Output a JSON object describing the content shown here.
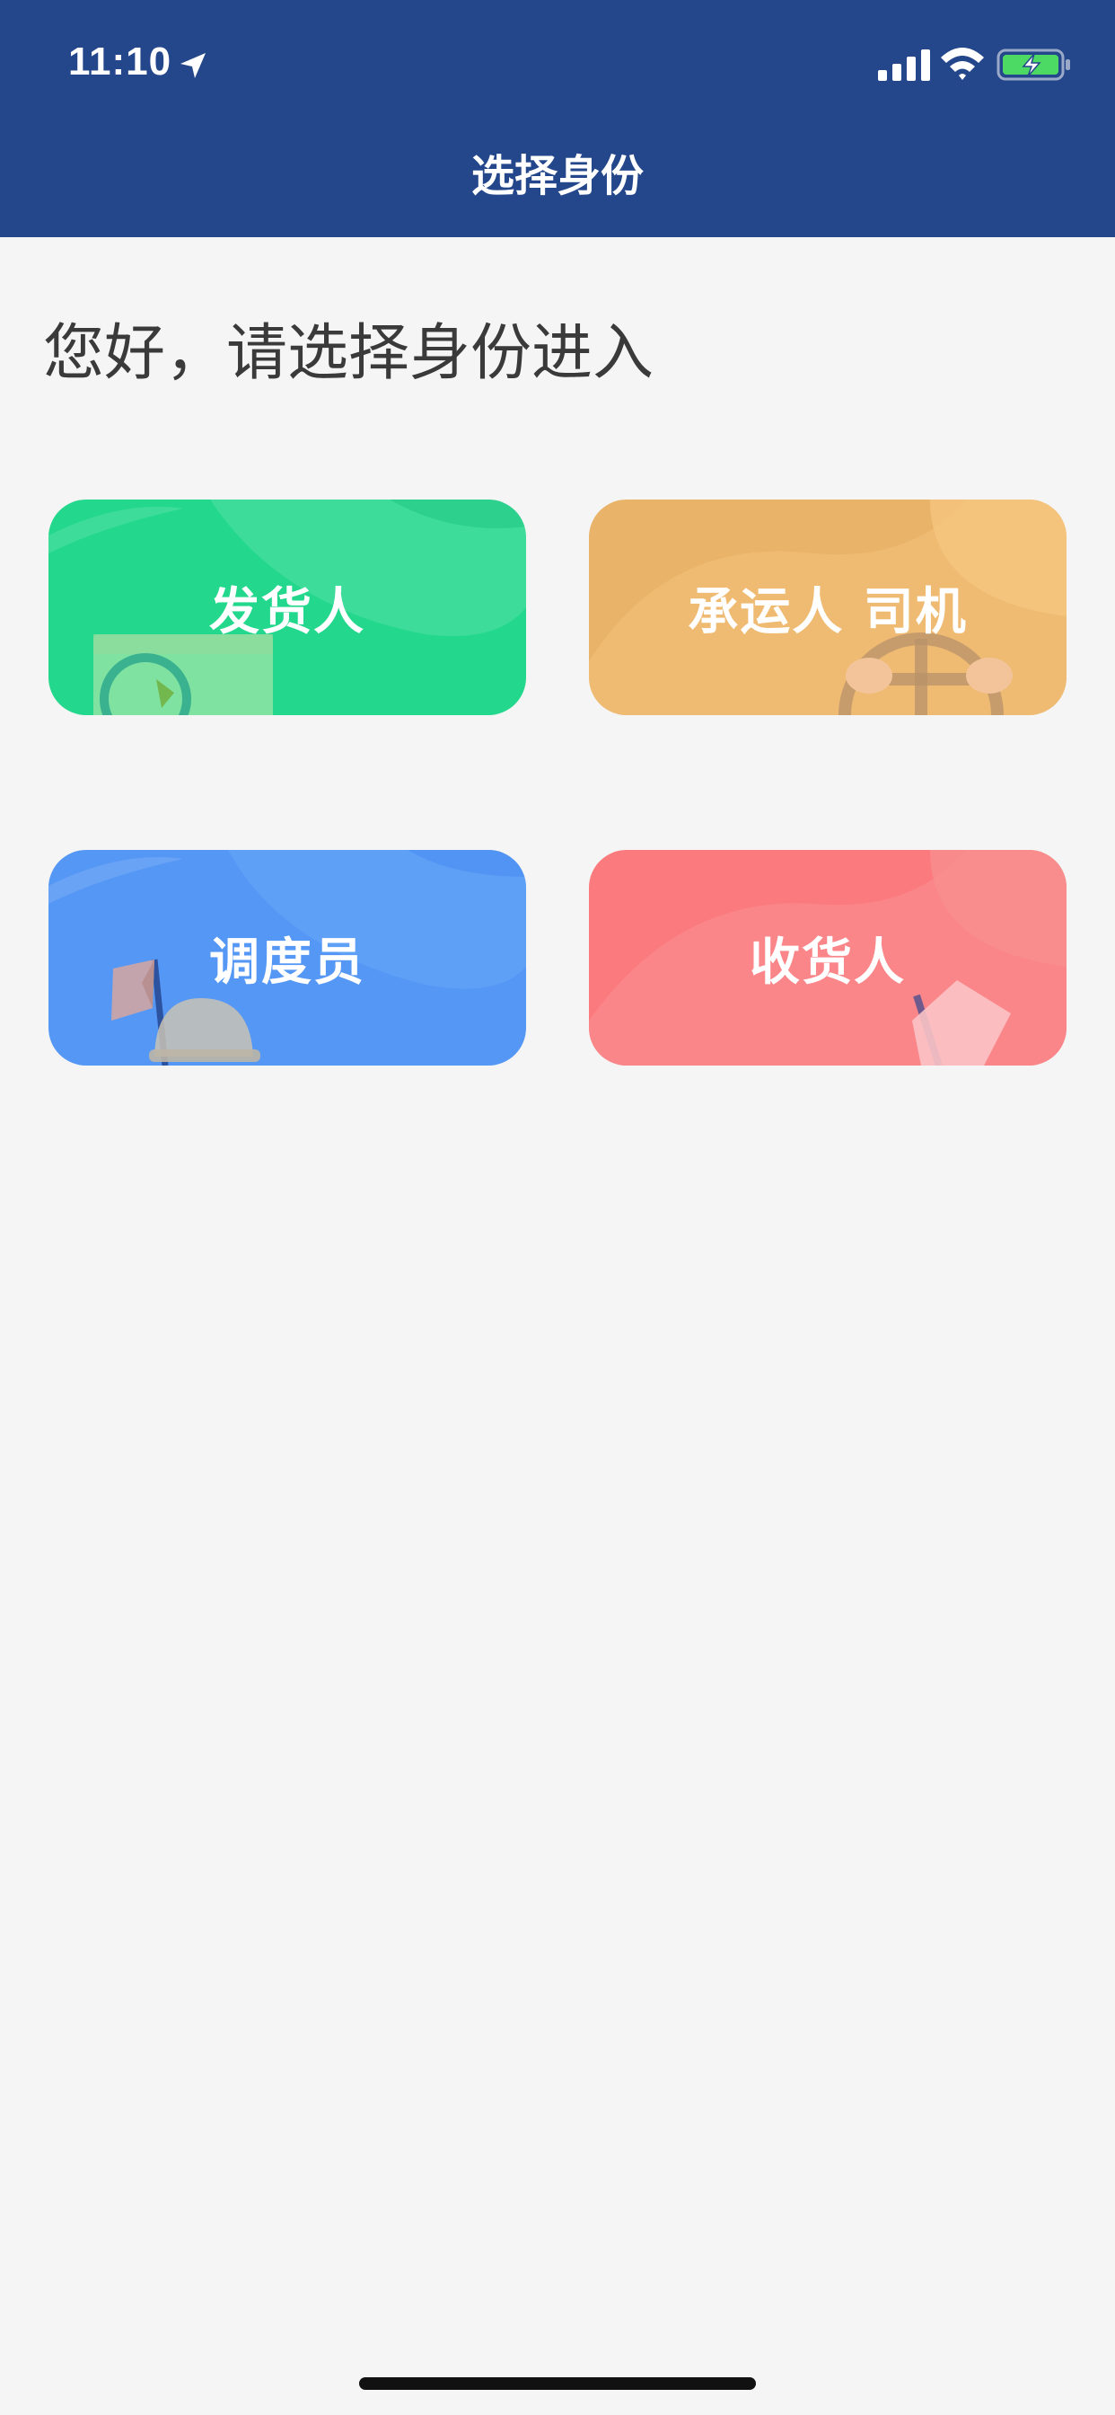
{
  "status_bar": {
    "time": "11:10",
    "icons": [
      "location-arrow-icon",
      "cellular-signal-icon",
      "wifi-icon",
      "battery-charging-icon"
    ]
  },
  "nav": {
    "title": "选择身份"
  },
  "greeting": "您好，请选择身份进入",
  "roles": [
    {
      "label": "发货人",
      "color": "#23d88d",
      "illustration": "package-icon"
    },
    {
      "label": "承运人 司机",
      "color": "#e9b36a",
      "illustration": "steering-wheel-icon"
    },
    {
      "label": "调度员",
      "color": "#5597f5",
      "illustration": "flag-helmet-icon"
    },
    {
      "label": "收货人",
      "color": "#fb7a7d",
      "illustration": "signboard-icon"
    }
  ],
  "colors": {
    "header": "#24478c",
    "background": "#f5f5f5",
    "greeting_text": "#3a3a3a"
  }
}
